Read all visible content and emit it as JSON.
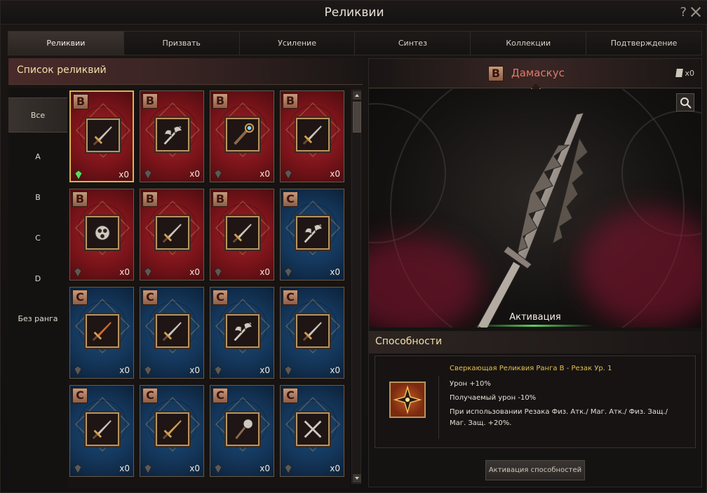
{
  "window": {
    "title": "Реликвии",
    "help_label": "?"
  },
  "tabs": [
    {
      "label": "Реликвии",
      "active": true
    },
    {
      "label": "Призвать",
      "active": false
    },
    {
      "label": "Усиление",
      "active": false
    },
    {
      "label": "Синтез",
      "active": false
    },
    {
      "label": "Коллекции",
      "active": false
    },
    {
      "label": "Подтверждение",
      "active": false
    }
  ],
  "list": {
    "title": "Список реликвий",
    "filters": [
      "Все",
      "A",
      "B",
      "C",
      "D",
      "Без ранга"
    ],
    "active_filter": "Все"
  },
  "relics": [
    {
      "grade": "B",
      "color": "red",
      "count": "x0",
      "icon": "greatsword-icon",
      "selected": true,
      "gem": "green"
    },
    {
      "grade": "B",
      "color": "red",
      "count": "x0",
      "icon": "double-axe-icon",
      "gem": "gray"
    },
    {
      "grade": "B",
      "color": "red",
      "count": "x0",
      "icon": "orb-staff-icon",
      "gem": "gray"
    },
    {
      "grade": "B",
      "color": "red",
      "count": "x0",
      "icon": "sword-icon",
      "gem": "gray"
    },
    {
      "grade": "B",
      "color": "red",
      "count": "x0",
      "icon": "fist-weapon-icon",
      "gem": "gray"
    },
    {
      "grade": "B",
      "color": "red",
      "count": "x0",
      "icon": "dagger-icon",
      "gem": "gray"
    },
    {
      "grade": "B",
      "color": "red",
      "count": "x0",
      "icon": "spear-icon",
      "gem": "gray"
    },
    {
      "grade": "C",
      "color": "blue",
      "count": "x0",
      "icon": "axe-icon",
      "gem": "gray"
    },
    {
      "grade": "C",
      "color": "blue",
      "count": "x0",
      "icon": "fire-sword-icon",
      "gem": "gray"
    },
    {
      "grade": "C",
      "color": "blue",
      "count": "x0",
      "icon": "short-sword-icon",
      "gem": "gray"
    },
    {
      "grade": "C",
      "color": "blue",
      "count": "x0",
      "icon": "battle-axe-icon",
      "gem": "gray"
    },
    {
      "grade": "C",
      "color": "blue",
      "count": "x0",
      "icon": "halberd-icon",
      "gem": "gray"
    },
    {
      "grade": "C",
      "color": "blue",
      "count": "x0",
      "icon": "dagger-icon",
      "gem": "gray"
    },
    {
      "grade": "C",
      "color": "blue",
      "count": "x0",
      "icon": "golden-sword-icon",
      "gem": "gray"
    },
    {
      "grade": "C",
      "color": "blue",
      "count": "x0",
      "icon": "mace-icon",
      "gem": "gray"
    },
    {
      "grade": "C",
      "color": "blue",
      "count": "x0",
      "icon": "crossed-swords-icon",
      "gem": "gray"
    }
  ],
  "detail": {
    "grade": "B",
    "name": "Дамаскус",
    "owned": "x0",
    "activation_label": "Активация",
    "abilities_title": "Способности",
    "ability": {
      "title": "Сверкающая Реликвия Ранга B - Резак Ур. 1",
      "lines": [
        "Урон +10%",
        "Получаемый урон -10%",
        "При использовании Резака Физ. Атк./ Маг. Атк./ Физ. Защ./ Маг. Защ. +20%."
      ]
    },
    "activate_button": "Активация способностей"
  },
  "colors": {
    "accent_gold": "#d9b64a",
    "title_gold": "#f0e0a8",
    "relic_name": "#e07a6a",
    "ability_title": "#e8c050",
    "red_card": "#7a141a",
    "blue_card": "#14365a"
  }
}
